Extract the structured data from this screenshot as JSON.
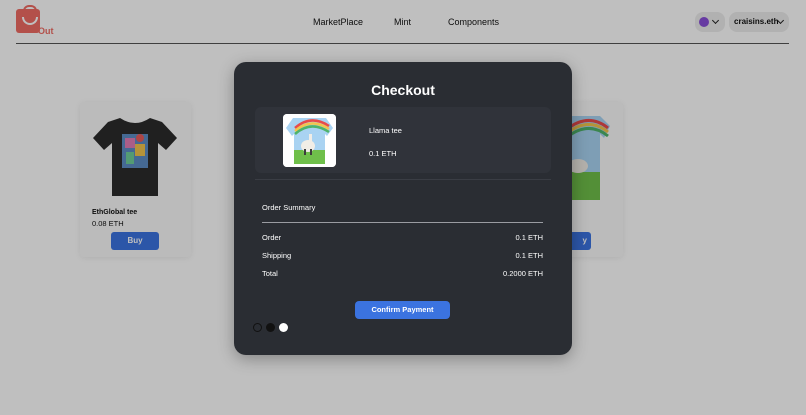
{
  "header": {
    "logo_text": "Out",
    "nav": [
      "MarketPlace",
      "Mint",
      "Components"
    ],
    "chain_icon": "ethereum-icon",
    "account": "craisins.eth"
  },
  "products": [
    {
      "title": "EthGlobal tee",
      "price": "0.08 ETH",
      "buy_label": "Buy"
    },
    {
      "buy_label": "y"
    }
  ],
  "modal": {
    "title": "Checkout",
    "item": {
      "name": "Llama tee",
      "price": "0.1 ETH"
    },
    "summary": {
      "heading": "Order Summary",
      "rows": [
        {
          "label": "Order",
          "value": "0.1 ETH"
        },
        {
          "label": "Shipping",
          "value": "0.1 ETH"
        },
        {
          "label": "Total",
          "value": "0.2000 ETH"
        }
      ]
    },
    "confirm_label": "Confirm Payment",
    "steps": {
      "count": 3,
      "current": 3
    }
  },
  "colors": {
    "accent": "#3b73e0",
    "modal_bg": "#2a2d33",
    "brand": "#ef6b63"
  }
}
